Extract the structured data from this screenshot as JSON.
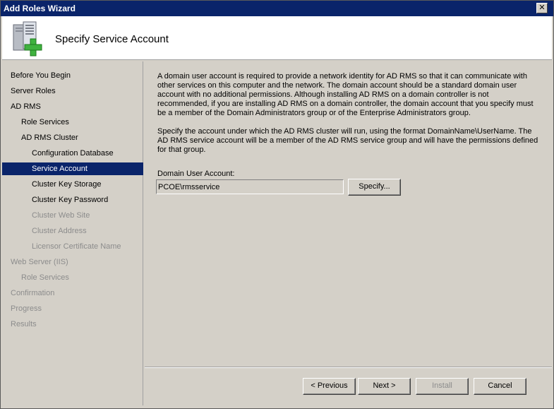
{
  "window": {
    "title": "Add Roles Wizard",
    "close_glyph": "✕"
  },
  "header": {
    "page_title": "Specify Service Account",
    "icon": "server-add-icon"
  },
  "sidebar": {
    "items": [
      {
        "label": "Before You Begin",
        "state": "normal"
      },
      {
        "label": "Server Roles",
        "state": "normal"
      },
      {
        "label": "AD RMS",
        "state": "normal"
      },
      {
        "label": "Role Services",
        "state": "normal"
      },
      {
        "label": "AD RMS Cluster",
        "state": "normal"
      },
      {
        "label": "Configuration Database",
        "state": "normal"
      },
      {
        "label": "Service Account",
        "state": "selected"
      },
      {
        "label": "Cluster Key Storage",
        "state": "normal"
      },
      {
        "label": "Cluster Key Password",
        "state": "normal"
      },
      {
        "label": "Cluster Web Site",
        "state": "disabled"
      },
      {
        "label": "Cluster Address",
        "state": "disabled"
      },
      {
        "label": "Licensor Certificate Name",
        "state": "disabled"
      },
      {
        "label": "Web Server (IIS)",
        "state": "disabled"
      },
      {
        "label": "Role Services",
        "state": "disabled"
      },
      {
        "label": "Confirmation",
        "state": "disabled"
      },
      {
        "label": "Progress",
        "state": "disabled"
      },
      {
        "label": "Results",
        "state": "disabled"
      }
    ]
  },
  "main": {
    "paragraph1": "A domain user account is required to provide a network identity for AD RMS so that it can communicate with other services on this computer and the network. The domain account should be a standard domain user account with no additional permissions. Although installing AD RMS on a domain controller is not recommended, if you are installing AD RMS on a domain controller, the domain account that you specify must be a member of the Domain Administrators group or of the Enterprise Administrators group.",
    "paragraph2": "Specify the account under which the AD RMS cluster will run, using the format DomainName\\UserName. The AD RMS service account will be a member of the AD RMS service group and will have the permissions defined for that group.",
    "account_label": "Domain User Account:",
    "account_value": "PCOE\\rmsservice",
    "specify_button": "Specify..."
  },
  "footer": {
    "previous": "< Previous",
    "next": "Next >",
    "install": "Install",
    "cancel": "Cancel"
  },
  "colors": {
    "selection": "#0a246a",
    "dialog_face": "#d4d0c8",
    "disabled_text": "#8c8c8c"
  }
}
